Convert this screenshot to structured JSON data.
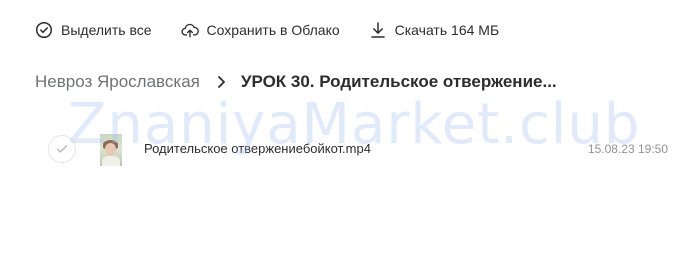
{
  "toolbar": {
    "select_all_label": "Выделить все",
    "save_to_cloud_label": "Сохранить в Облако",
    "download_label": "Скачать 164 МБ"
  },
  "breadcrumb": {
    "parent": "Невроз Ярославская",
    "current": "УРОК 30. Родительское отвержение..."
  },
  "files": [
    {
      "name": "Родительское отвержениебойкот.mp4",
      "date": "15.08.23 19:50"
    }
  ],
  "watermark": "ZnaniyaMarket.club",
  "icons": {
    "select_all": "check-circle-icon",
    "save_to_cloud": "cloud-upload-icon",
    "download": "download-icon",
    "breadcrumb_separator": "chevron-right-icon",
    "row_check": "check-icon"
  }
}
